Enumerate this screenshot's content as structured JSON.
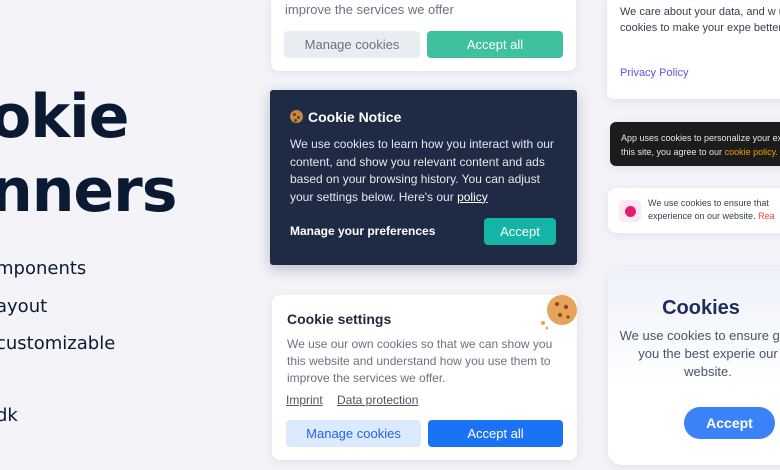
{
  "hero": {
    "title_line1": "okie",
    "title_line2": "nners",
    "features": [
      "mponents",
      "ayout",
      "customizable",
      "dk"
    ]
  },
  "card_top": {
    "text": "improve the services we offer",
    "manage_label": "Manage cookies",
    "accept_label": "Accept all",
    "accept_color": "#3fc1a0"
  },
  "cookie_notice": {
    "title": "Cookie Notice",
    "body": "We use cookies to learn how you interact with our content, and show you relevant content and ads based on your browsing history. You can adjust your settings below. Here's our",
    "policy_link": "policy",
    "preferences_label": "Manage your preferences",
    "accept_label": "Accept",
    "bg_color": "#1f2a44",
    "accept_color": "#14b5a6"
  },
  "cookie_settings": {
    "title": "Cookie settings",
    "body": "We use our own cookies so that we can show you this website and understand how you use them to improve the services we offer.",
    "imprint_label": "Imprint",
    "data_protection_label": "Data protection",
    "manage_label": "Manage cookies",
    "accept_label": "Accept all",
    "accept_color": "#1a73f5"
  },
  "right_privacy": {
    "body": "We care about your data, and w use cookies to make your expe better.",
    "link": "Privacy Policy"
  },
  "right_dark": {
    "body": "App uses cookies to personalize your exp this site, you agree to our",
    "link": "cookie policy."
  },
  "right_small": {
    "body": "We use cookies to ensure that experience on our website.",
    "link": "Rea"
  },
  "right_big": {
    "title": "Cookies",
    "body": "We use cookies to ensure give you the best experie our website.",
    "accept_label": "Accept",
    "accept_color": "#3b82f6"
  }
}
